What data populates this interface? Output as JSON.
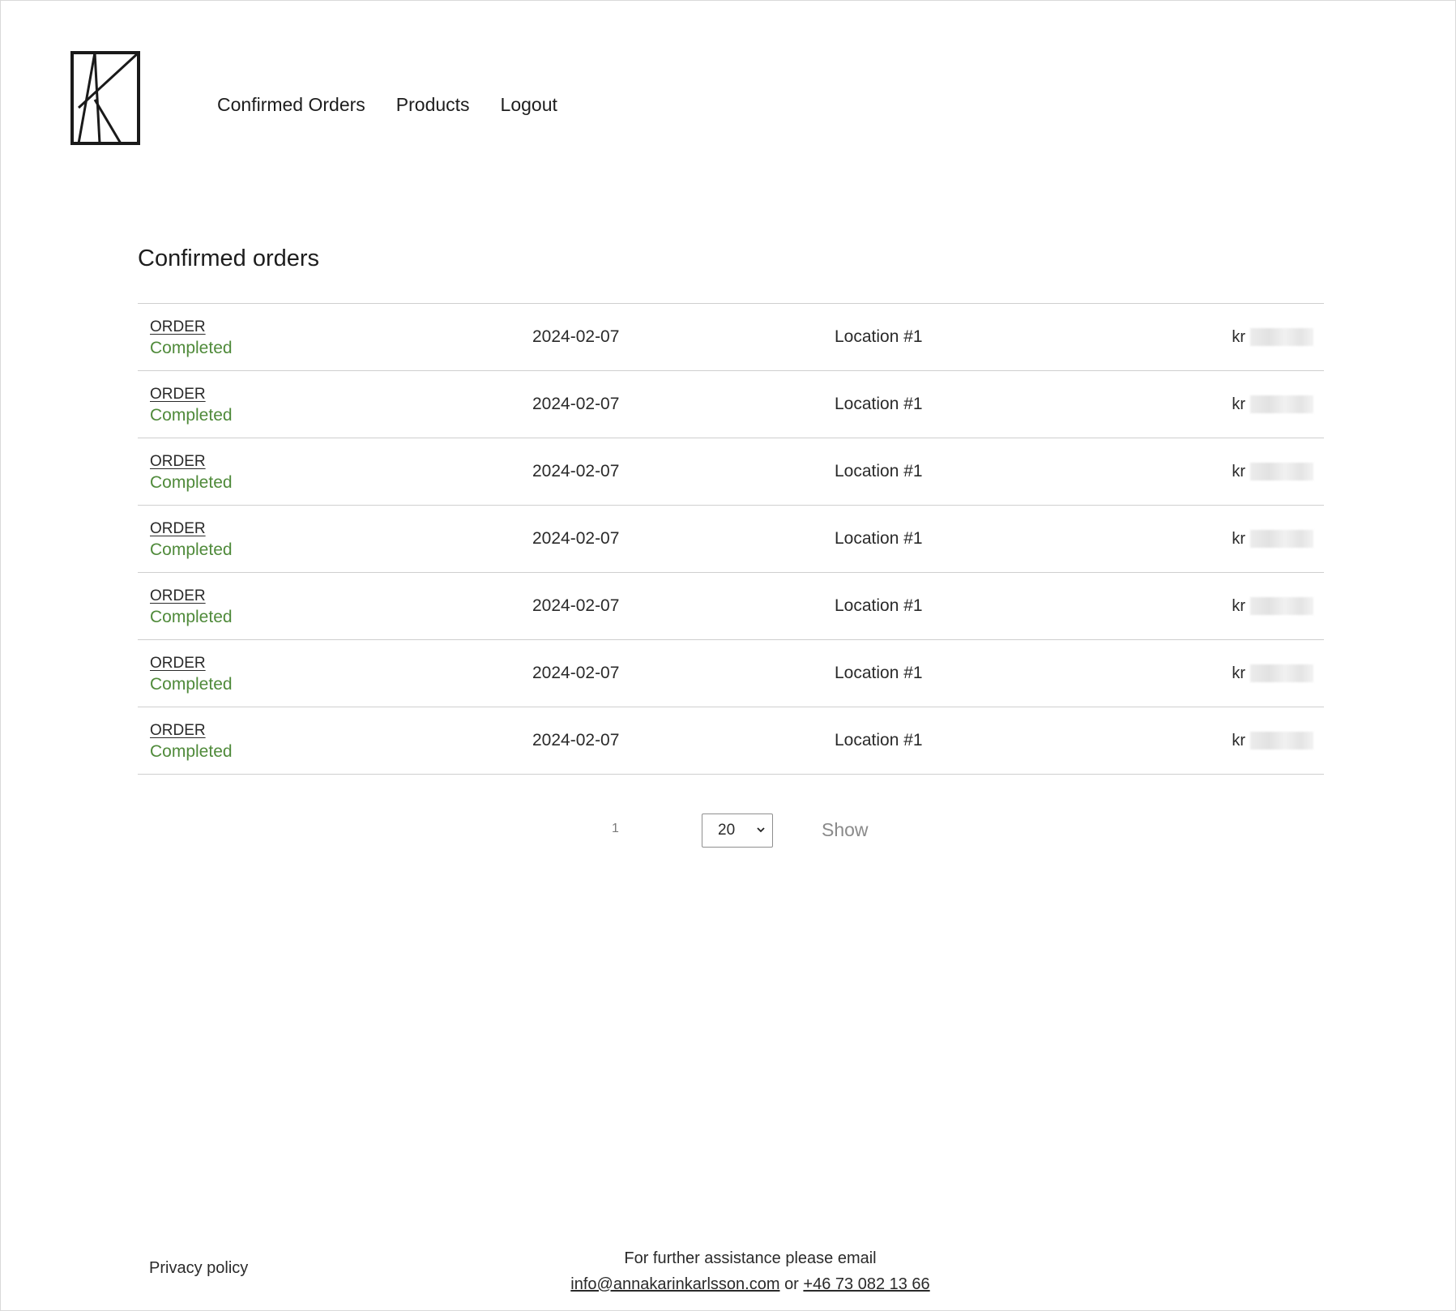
{
  "header": {
    "nav": [
      {
        "label": "Confirmed Orders"
      },
      {
        "label": "Products"
      },
      {
        "label": "Logout"
      }
    ]
  },
  "main": {
    "title": "Confirmed orders",
    "currency": "kr",
    "orders": [
      {
        "id": "ORDER",
        "status": "Completed",
        "date": "2024-02-07",
        "location": "Location #1"
      },
      {
        "id": "ORDER",
        "status": "Completed",
        "date": "2024-02-07",
        "location": "Location #1"
      },
      {
        "id": "ORDER",
        "status": "Completed",
        "date": "2024-02-07",
        "location": "Location #1"
      },
      {
        "id": "ORDER",
        "status": "Completed",
        "date": "2024-02-07",
        "location": "Location #1"
      },
      {
        "id": "ORDER",
        "status": "Completed",
        "date": "2024-02-07",
        "location": "Location #1"
      },
      {
        "id": "ORDER",
        "status": "Completed",
        "date": "2024-02-07",
        "location": "Location #1"
      },
      {
        "id": "ORDER",
        "status": "Completed",
        "date": "2024-02-07",
        "location": "Location #1"
      }
    ]
  },
  "pagination": {
    "current_page": "1",
    "per_page": "20",
    "show_label": "Show"
  },
  "footer": {
    "privacy_label": "Privacy policy",
    "assist_text": "For further assistance please email",
    "email": "info@annakarinkarlsson.com",
    "or_text": "or",
    "phone": "+46 73 082 13 66"
  },
  "colors": {
    "status_completed": "#4f8a3a",
    "text": "#1d1d1d",
    "divider": "#cfcfcf"
  }
}
